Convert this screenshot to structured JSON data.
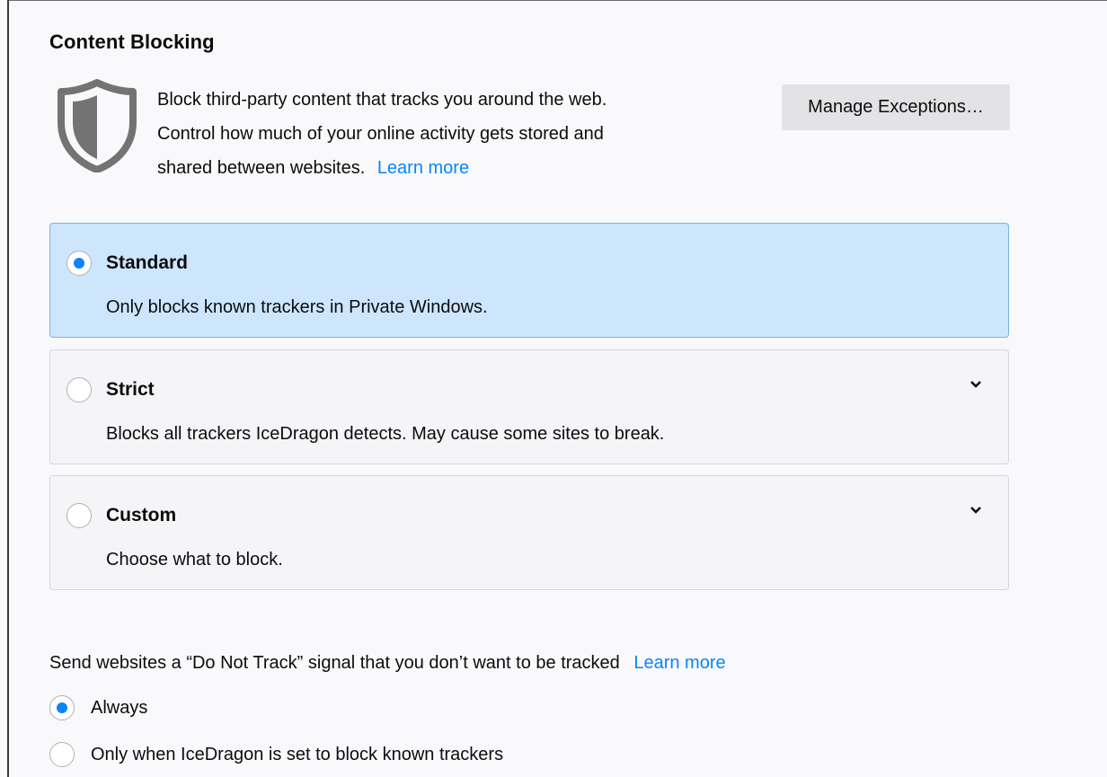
{
  "section": {
    "title": "Content Blocking",
    "description_line1": "Block third-party content that tracks you around the web.",
    "description_line2": "Control how much of your online activity gets stored and",
    "description_line3": "shared between websites.",
    "learn_more": "Learn more",
    "manage_button": "Manage Exceptions…"
  },
  "options": [
    {
      "title": "Standard",
      "description": "Only blocks known trackers in Private Windows.",
      "selected": true
    },
    {
      "title": "Strict",
      "description": "Blocks all trackers IceDragon detects. May cause some sites to break.",
      "selected": false
    },
    {
      "title": "Custom",
      "description": "Choose what to block.",
      "selected": false
    }
  ],
  "dnt": {
    "label": "Send websites a “Do Not Track” signal that you don’t want to be tracked",
    "learn_more": "Learn more",
    "choices": [
      {
        "label": "Always",
        "selected": true
      },
      {
        "label": "Only when IceDragon is set to block known trackers",
        "selected": false
      }
    ]
  },
  "colors": {
    "accent": "#0a84ff",
    "selected_bg": "#cde6fc",
    "shield": "#737373"
  },
  "icons": {
    "shield": "shield-icon",
    "chevron": "chevron-down-icon"
  }
}
